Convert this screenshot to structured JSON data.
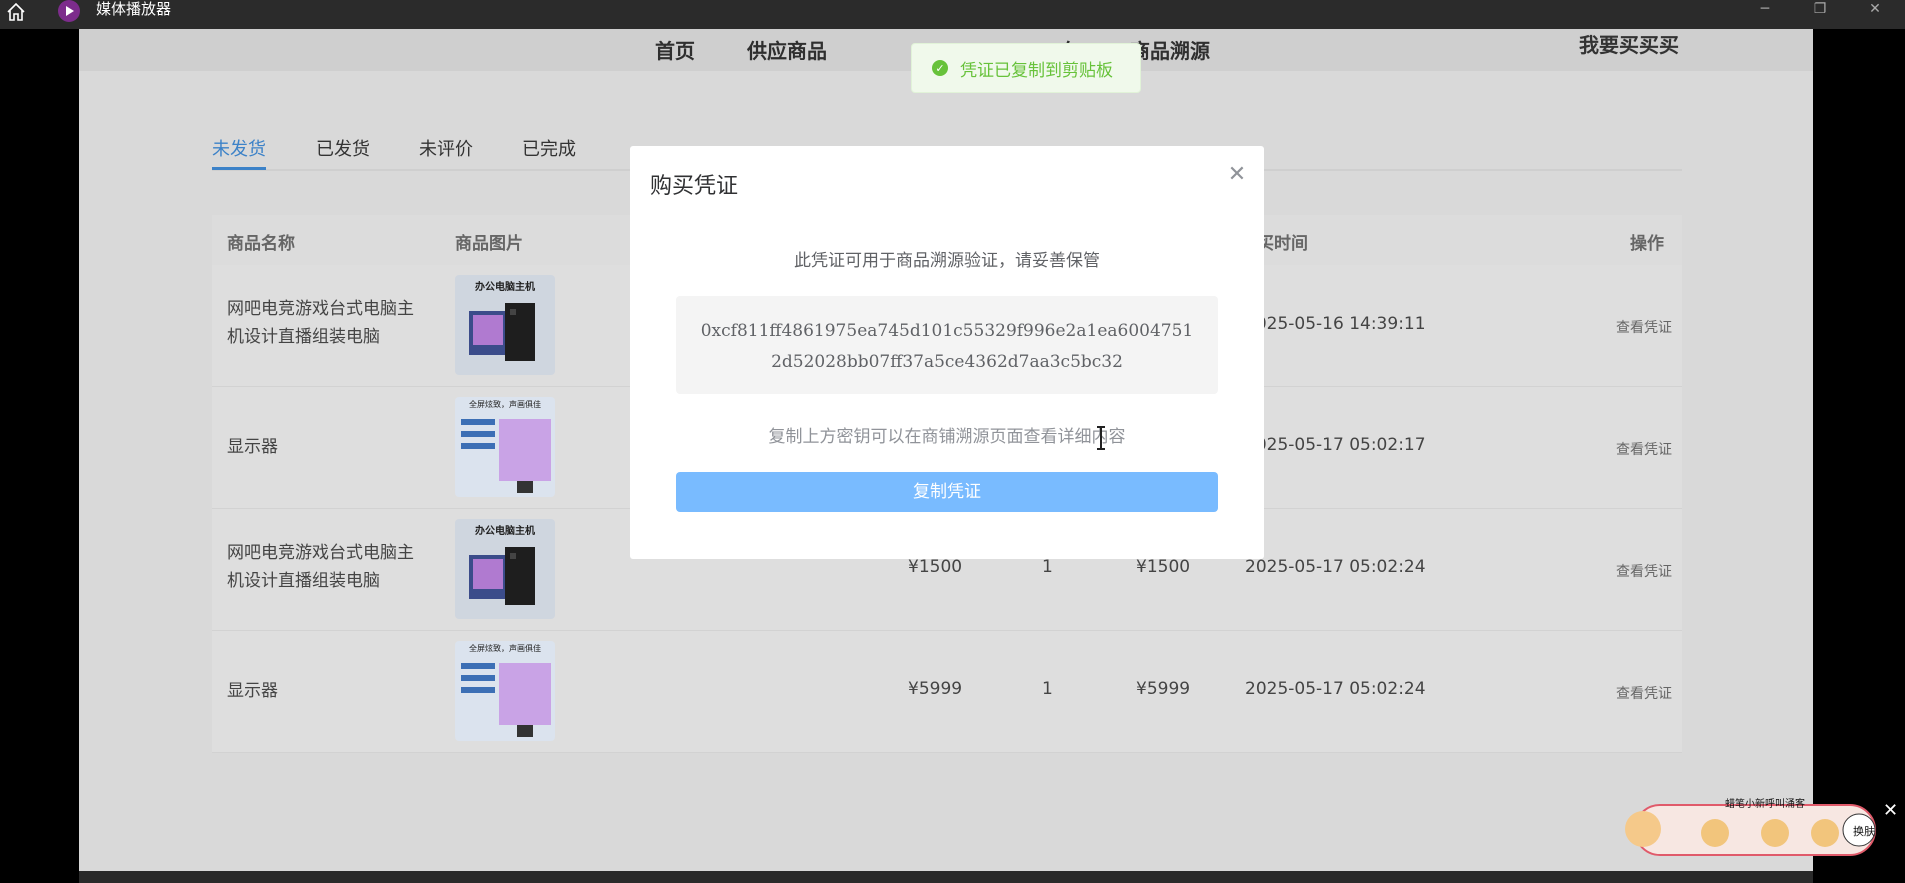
{
  "window": {
    "title": "媒体播放器"
  },
  "nav": {
    "items": [
      "首页",
      "供应商品",
      "车",
      "商品溯源"
    ],
    "user": "我要买买买"
  },
  "toast": {
    "message": "凭证已复制到剪贴板"
  },
  "tabs": [
    "未发货",
    "已发货",
    "未评价",
    "已完成"
  ],
  "table": {
    "headers": [
      "商品名称",
      "商品图片",
      "买时间",
      "操作"
    ],
    "rows": [
      {
        "name": "网吧电竞游戏台式电脑主机设计直播组装电脑",
        "image": "desktop-pc",
        "price": "",
        "qty": "",
        "total": "",
        "time": "2025-05-16 14:39:11",
        "action": "查看凭证"
      },
      {
        "name": "显示器",
        "image": "monitor",
        "price": "",
        "qty": "",
        "total": "",
        "time": "2025-05-17 05:02:17",
        "action": "查看凭证"
      },
      {
        "name": "网吧电竞游戏台式电脑主机设计直播组装电脑",
        "image": "desktop-pc",
        "price": "¥1500",
        "qty": "1",
        "total": "¥1500",
        "time": "2025-05-17 05:02:24",
        "action": "查看凭证"
      },
      {
        "name": "显示器",
        "image": "monitor",
        "price": "¥5999",
        "qty": "1",
        "total": "¥5999",
        "time": "2025-05-17 05:02:24",
        "action": "查看凭证"
      }
    ],
    "thumbs": {
      "desktop_title": "办公电脑主机",
      "monitor_title": "全屏炫致，声画俱佳"
    }
  },
  "dialog": {
    "title": "购买凭证",
    "description": "此凭证可用于商品溯源验证，请妥善保管",
    "key": "0xcf811ff4861975ea745d101c55329f996e2a1ea60047512d52028bb07ff37a5ce4362d7aa3c5bc32",
    "hint": "复制上方密钥可以在商铺溯源页面查看详细内容",
    "copy_button": "复制凭证"
  },
  "widget": {
    "text": "蜡笔小新呼叫涌客",
    "button": "换肤"
  },
  "colors": {
    "accent": "#3c82c8",
    "button": "#79bbff",
    "success": "#67c23a"
  }
}
